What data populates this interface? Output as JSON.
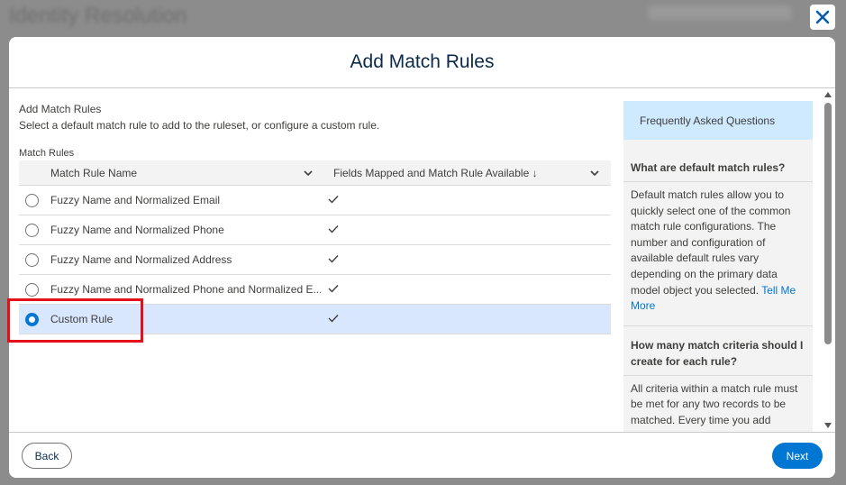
{
  "background": {
    "page_title": "Identity Resolution"
  },
  "modal": {
    "title": "Add Match Rules",
    "section_title": "Add Match Rules",
    "section_desc": "Select a default match rule to add to the ruleset, or configure a custom rule.",
    "match_rules_label": "Match Rules",
    "columns": [
      "Match Rule Name",
      "Fields Mapped and Match Rule Available ↓"
    ],
    "rows": [
      {
        "name": "Fuzzy Name and Normalized Email",
        "available": true,
        "selected": false
      },
      {
        "name": "Fuzzy Name and Normalized Phone",
        "available": true,
        "selected": false
      },
      {
        "name": "Fuzzy Name and Normalized Address",
        "available": true,
        "selected": false
      },
      {
        "name": "Fuzzy Name and Normalized Phone and Normalized E...",
        "available": true,
        "selected": false
      },
      {
        "name": "Custom Rule",
        "available": true,
        "selected": true
      }
    ],
    "faq": {
      "header": "Frequently Asked Questions",
      "q1": "What are default match rules?",
      "a1": "Default match rules allow you to quickly select one of the common match rule configurations. The number and configuration of available default rules vary depending on the primary data model object you selected.",
      "a1_link": "Tell Me More",
      "q2": "How many match criteria should I create for each rule?",
      "a2": "All criteria within a match rule must be met for any two records to be matched. Every time you add criteria, you raise the bar for matching by that"
    },
    "footer": {
      "back_label": "Back",
      "next_label": "Next"
    }
  },
  "colors": {
    "accent": "#0176d3",
    "selected_row": "#d8e6fe",
    "highlight": "#e3101c",
    "faq_header": "#cfe9fe"
  },
  "icons": {
    "close": "close-icon",
    "sort": "chevron-down-icon",
    "check": "check-icon"
  }
}
